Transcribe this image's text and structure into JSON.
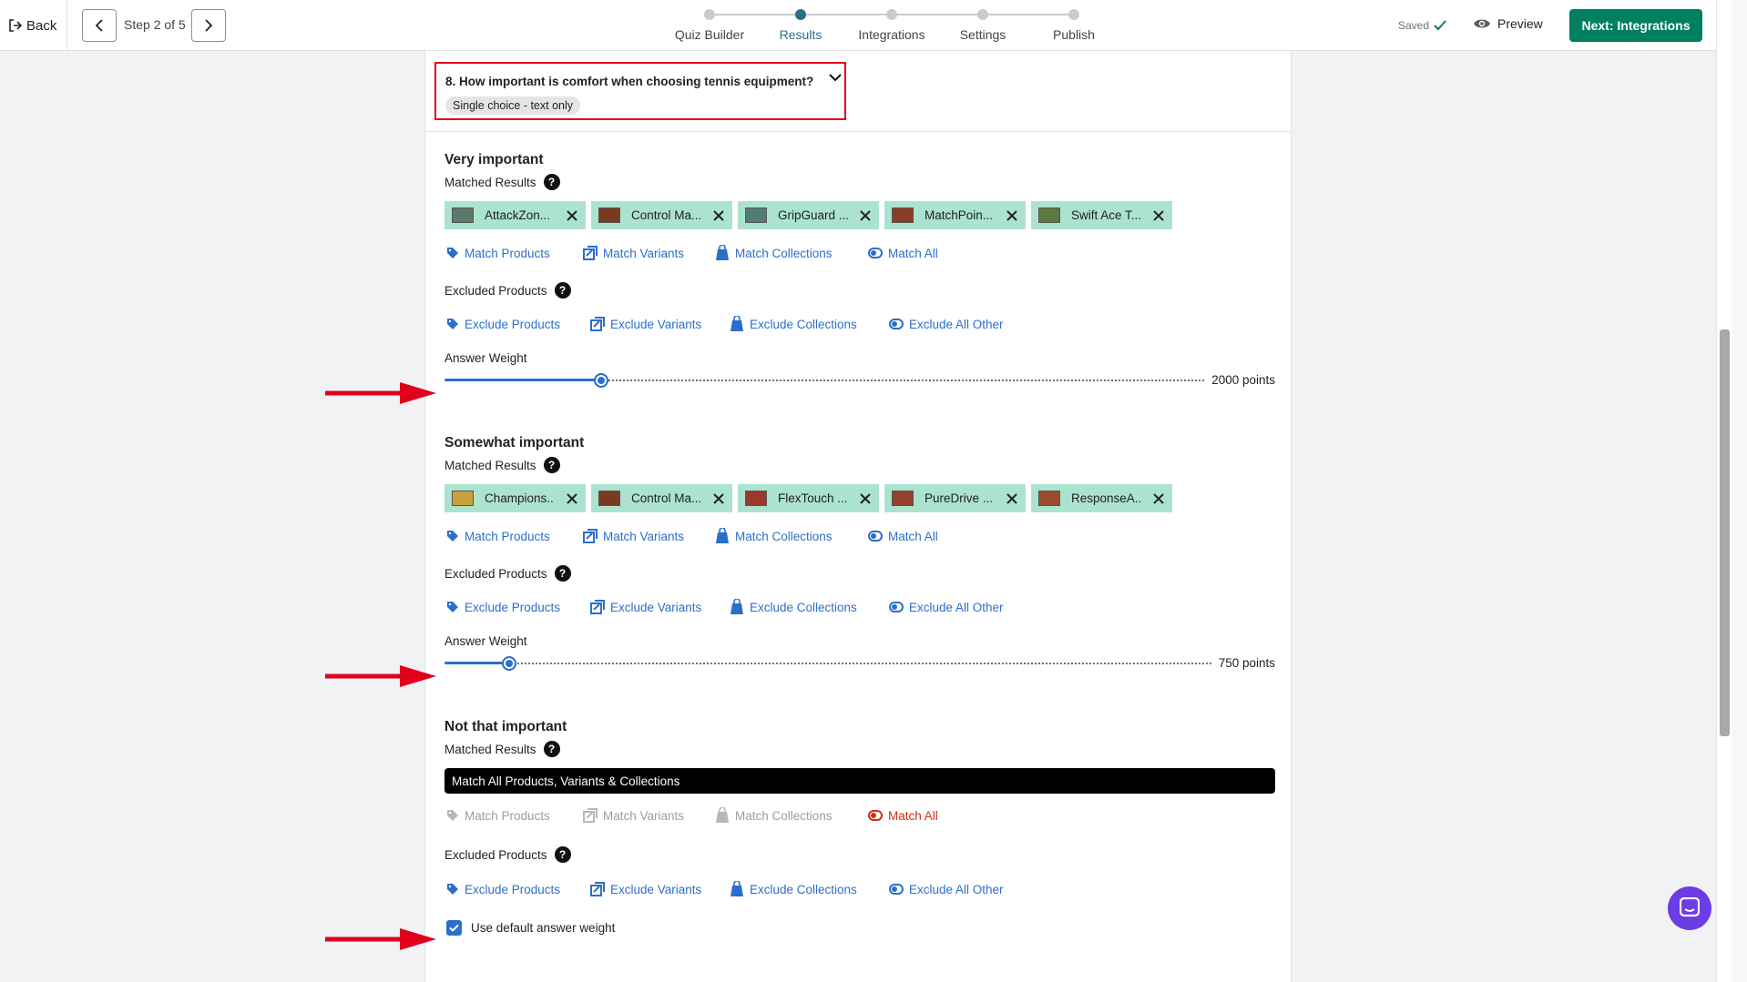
{
  "topbar": {
    "back_label": "Back",
    "step_text": "Step 2 of 5",
    "steps": [
      {
        "label": "Quiz Builder",
        "active": false
      },
      {
        "label": "Results",
        "active": true
      },
      {
        "label": "Integrations",
        "active": false
      },
      {
        "label": "Settings",
        "active": false
      },
      {
        "label": "Publish",
        "active": false
      }
    ],
    "saved_label": "Saved",
    "preview_label": "Preview",
    "next_label": "Next: Integrations"
  },
  "question": {
    "title": "8. How important is comfort when choosing tennis equipment?",
    "type_badge": "Single choice - text only"
  },
  "labels": {
    "matched_results": "Matched Results",
    "excluded_products": "Excluded Products",
    "answer_weight": "Answer Weight",
    "match_products": "Match Products",
    "match_variants": "Match Variants",
    "match_collections": "Match Collections",
    "match_all": "Match All",
    "exclude_products": "Exclude Products",
    "exclude_variants": "Exclude Variants",
    "exclude_collections": "Exclude Collections",
    "exclude_all_other": "Exclude All Other",
    "match_all_bar": "Match All Products, Variants & Collections",
    "use_default_weight": "Use default answer weight"
  },
  "answers": [
    {
      "title": "Very important",
      "products": [
        {
          "name": "AttackZon...",
          "thumb_color": "#5b7a6b"
        },
        {
          "name": "Control Ma...",
          "thumb_color": "#7a3a22"
        },
        {
          "name": "GripGuard ...",
          "thumb_color": "#4f7d77"
        },
        {
          "name": "MatchPoin...",
          "thumb_color": "#8a3d26"
        },
        {
          "name": "Swift Ace T...",
          "thumb_color": "#5d7a3e"
        }
      ],
      "weight_text": "2000 points",
      "weight_fraction": 0.206
    },
    {
      "title": "Somewhat important",
      "products": [
        {
          "name": "Champions...",
          "thumb_color": "#c9a13a"
        },
        {
          "name": "Control Ma...",
          "thumb_color": "#7a3a22"
        },
        {
          "name": "FlexTouch ...",
          "thumb_color": "#9a3a28"
        },
        {
          "name": "PureDrive ...",
          "thumb_color": "#93412c"
        },
        {
          "name": "ResponseA...",
          "thumb_color": "#9a4a2e"
        }
      ],
      "weight_text": "750 points",
      "weight_fraction": 0.084
    },
    {
      "title": "Not that important"
    }
  ],
  "colors": {
    "accent_blue": "#2c6ecb",
    "primary_green": "#008060",
    "chip_green": "#abe3cf",
    "highlight_red": "#e0001b",
    "chat_purple": "#6c3ce5"
  }
}
